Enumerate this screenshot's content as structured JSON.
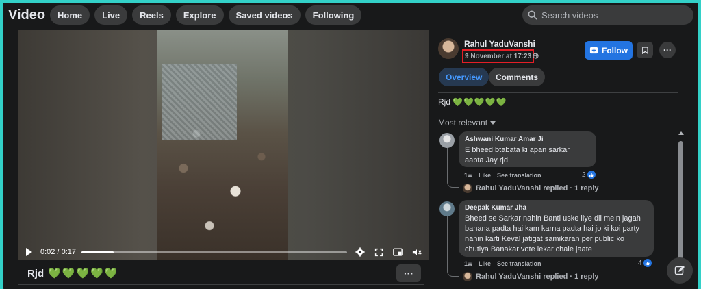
{
  "app": {
    "title": "Video"
  },
  "nav": {
    "items": [
      "Home",
      "Live",
      "Reels",
      "Explore",
      "Saved videos",
      "Following"
    ]
  },
  "search": {
    "placeholder": "Search videos",
    "value": ""
  },
  "video": {
    "time_current": "0:02",
    "time_total": "0:17",
    "time_display": "0:02 / 0:17",
    "progress_fraction": 0.12,
    "caption": "Rjd",
    "caption_hearts": "💚💚💚💚💚"
  },
  "post": {
    "author": "Rahul YaduVanshi",
    "timestamp": "9 November at 17:23",
    "follow_label": "Follow",
    "tabs": [
      {
        "label": "Overview",
        "active": true
      },
      {
        "label": "Comments",
        "active": false
      }
    ],
    "text": "Rjd",
    "text_hearts": "💚💚💚💚💚"
  },
  "comments": {
    "sort_label": "Most relevant",
    "items": [
      {
        "name": "Ashwani Kumar Amar Ji",
        "text": "E bheed btabata ki apan sarkar aabta Jay rjd",
        "age": "1w",
        "like": "Like",
        "translate": "See translation",
        "reactions": "2",
        "reply_summary": "Rahul YaduVanshi replied · 1 reply"
      },
      {
        "name": "Deepak Kumar Jha",
        "text": "Bheed se Sarkar nahin Banti uske liye dil mein jagah banana padta hai kam karna padta hai jo ki koi party nahin karti Keval jatigat samikaran per public ko chutiya Banakar vote lekar chale jaate",
        "age": "1w",
        "like": "Like",
        "translate": "See translation",
        "reactions": "4",
        "reply_summary": "Rahul YaduVanshi replied · 1 reply"
      }
    ]
  },
  "colors": {
    "accent": "#2374e1",
    "highlight_box": "#e41e26",
    "heart": "#31a24c",
    "background": "#18191a"
  }
}
